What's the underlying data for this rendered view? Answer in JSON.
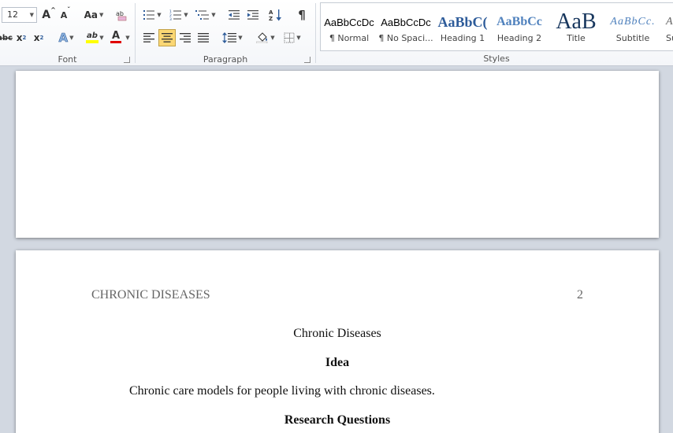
{
  "font_group": {
    "label": "Font",
    "font_size": "12",
    "grow_font": "A",
    "shrink_font": "A",
    "change_case": "Aa",
    "strikethrough": "abc",
    "subscript": "x",
    "subscript_mark": "2",
    "superscript": "x",
    "superscript_mark": "2",
    "text_effects": "A",
    "highlight": "ab",
    "font_color": "A"
  },
  "paragraph_group": {
    "label": "Paragraph",
    "pilcrow": "¶"
  },
  "styles_group": {
    "label": "Styles",
    "items": [
      {
        "sample": "AaBbCcDc",
        "name": "¶ Normal"
      },
      {
        "sample": "AaBbCcDc",
        "name": "¶ No Spaci..."
      },
      {
        "sample": "AaBbC(",
        "name": "Heading 1"
      },
      {
        "sample": "AaBbCc",
        "name": "Heading 2"
      },
      {
        "sample": "AaB",
        "name": "Title"
      },
      {
        "sample": "AaBbCc.",
        "name": "Subtitle"
      },
      {
        "sample": "A",
        "name": "Su"
      }
    ]
  },
  "colors": {
    "accent_blue": "#2e5c9a",
    "highlight_yellow": "#ffff00",
    "font_red": "#e00000",
    "active_button": "#fbd774"
  },
  "document": {
    "header_title": "CHRONIC DISEASES",
    "header_page": "2",
    "title": "Chronic Diseases",
    "heading_idea": "Idea",
    "paragraph_1": "Chronic care models for people living with chronic diseases.",
    "heading_research": "Research Questions"
  }
}
